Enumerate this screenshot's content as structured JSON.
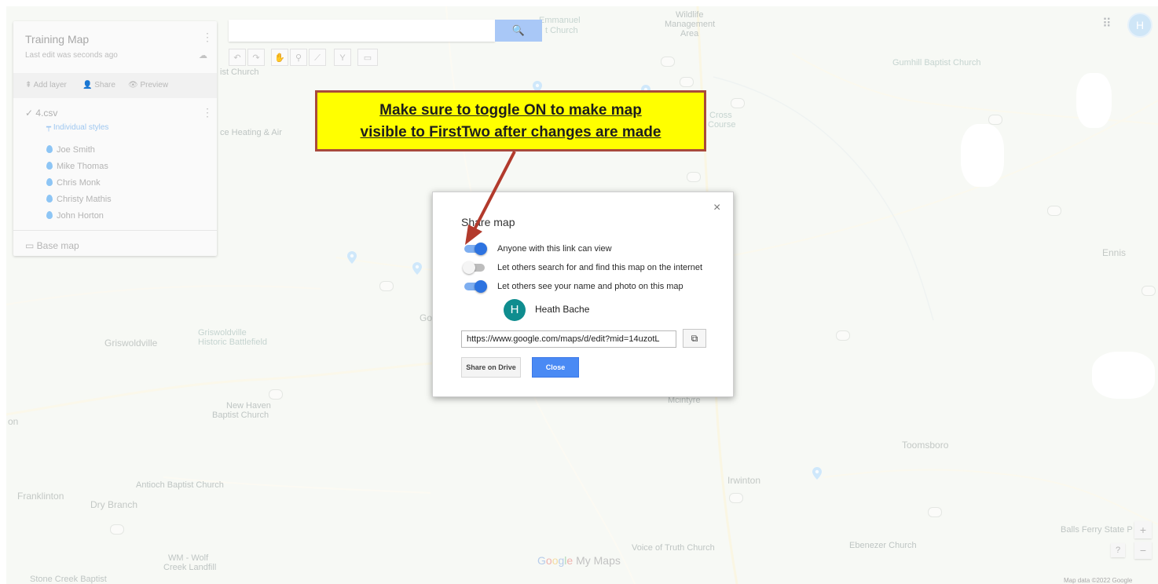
{
  "panel": {
    "title": "Training Map",
    "subtitle": "Last edit was seconds ago",
    "actions": {
      "add_layer": "Add layer",
      "share": "Share",
      "preview": "Preview"
    },
    "layer_name": "4.csv",
    "style_label": "Individual styles",
    "entries": [
      "Joe Smith",
      "Mike Thomas",
      "Chris Monk",
      "Christy Mathis",
      "John Horton"
    ],
    "base_map": "Base map"
  },
  "search": {
    "button_icon": "search-icon"
  },
  "account_initial": "H",
  "callout": {
    "line1": "Make sure to toggle ON to make map",
    "line2": "visible to FirstTwo after changes are made"
  },
  "dialog": {
    "title": "Share map",
    "close_symbol": "×",
    "options": [
      {
        "label": "Anyone with this link can view",
        "on": true
      },
      {
        "label": "Let others search for and find this map on the internet",
        "on": false
      },
      {
        "label": "Let others see your name and photo on this map",
        "on": true
      }
    ],
    "user_initial": "H",
    "user_name": "Heath Bache",
    "link_value": "https://www.google.com/maps/d/edit?mid=14uzotL",
    "share_drive_label": "Share on Drive",
    "close_label": "Close"
  },
  "map_labels": {
    "emmanuel": "Emmanuel",
    "church_a": "t Church",
    "wildlife1": "Wildlife",
    "wildlife2": "Management",
    "wildlife3": "Area",
    "gumhill": "Gumhill Baptist Church",
    "ist_church": "ist Church",
    "heating": "ce Heating & Air",
    "cross1": "Cross",
    "cross2": "Course",
    "ennis": "Ennis",
    "griswoldville": "Griswoldville",
    "gris_hist1": "Griswoldville",
    "gris_hist2": "Historic Battlefield",
    "go": "Go",
    "newhaven1": "New Haven",
    "newhaven2": "Baptist Church",
    "mcintyre": "Mcintyre",
    "toomsboro": "Toomsboro",
    "irwinton": "Irwinton",
    "antioch": "Antioch Baptist Church",
    "franklinton": "Franklinton",
    "drybranch": "Dry Branch",
    "ballsferry": "Balls Ferry State P",
    "ebenezer": "Ebenezer Church",
    "voice": "Voice of Truth Church",
    "wm1": "WM - Wolf",
    "wm2": "Creek Landfill",
    "stonecreek": "Stone Creek Baptist",
    "on": "on"
  },
  "brand": {
    "g1": "G",
    "g2": "o",
    "g3": "o",
    "g4": "g",
    "g5": "l",
    "g6": "e",
    "rest": " My Maps"
  },
  "map_data": "Map data ©2022 Google",
  "zoom": {
    "plus": "+",
    "minus": "−",
    "help": "?"
  },
  "colors": {
    "callout_bg": "#ffff00",
    "callout_border": "#a84a3c",
    "toggle_on": "#2d73e0",
    "primary_button": "#4a8af4",
    "avatar": "#0f8d8f"
  }
}
